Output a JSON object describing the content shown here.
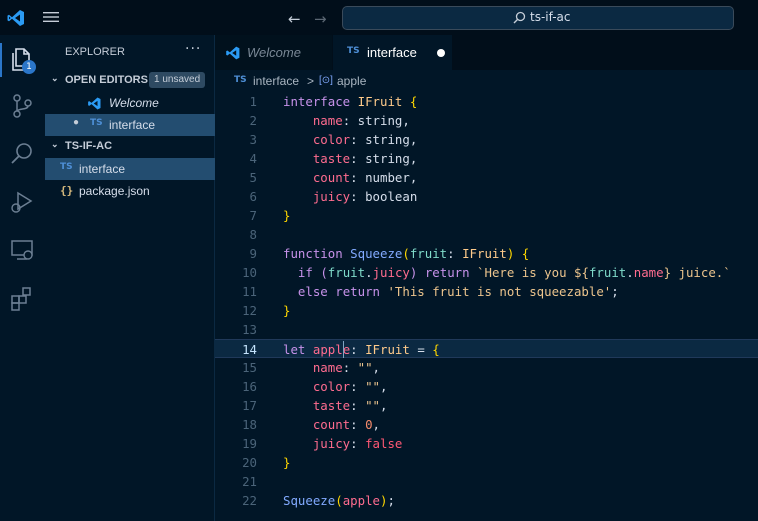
{
  "title_bar": {
    "back_glyph": "←",
    "forward_glyph": "→",
    "search_text": "ts-if-ac",
    "icons": [
      "vscode-logo-icon",
      "hamburger-menu-icon",
      "search-icon"
    ]
  },
  "activity_bar": {
    "icons": [
      "files-icon",
      "source-control-icon",
      "search-icon",
      "run-debug-icon",
      "remote-explorer-icon",
      "extensions-icon"
    ],
    "badge": "1"
  },
  "sidebar": {
    "title": "EXPLORER",
    "more_glyph": "···",
    "open_editors": {
      "label": "OPEN EDITORS",
      "badge": "1 unsaved",
      "chevron": "⌄",
      "items": [
        {
          "icon_label": "",
          "icon_name": "vscode-logo-icon",
          "label": "Welcome"
        },
        {
          "icon_label": "TS",
          "icon_name": "typescript-file-icon",
          "label": "interface",
          "dirty_glyph": "●"
        }
      ]
    },
    "workspace": {
      "label": "TS-IF-AC",
      "chevron": "⌄",
      "items": [
        {
          "icon_label": "TS",
          "icon_name": "typescript-file-icon",
          "label": "interface"
        },
        {
          "icon_label": "{}",
          "icon_name": "json-file-icon",
          "label": "package.json"
        }
      ]
    }
  },
  "tabs": [
    {
      "label": "Welcome",
      "icon_name": "vscode-logo-icon",
      "active": false
    },
    {
      "label": "interface",
      "icon_label": "TS",
      "icon_name": "typescript-file-icon",
      "active": true
    }
  ],
  "breadcrumb": {
    "file_icon": "TS",
    "file": "interface",
    "separator": ">",
    "symbol_icon": "[⊙]",
    "symbol": "apple"
  },
  "editor": {
    "current_line": 14,
    "lines": [
      {
        "n": "1",
        "tokens": [
          [
            "kw",
            "interface"
          ],
          [
            "va",
            " "
          ],
          [
            "ty",
            "IFruit"
          ],
          [
            "va",
            " "
          ],
          [
            "br",
            "{"
          ]
        ]
      },
      {
        "n": "2",
        "tokens": [
          [
            "va",
            "    "
          ],
          [
            "pr",
            "name"
          ],
          [
            "va",
            ": "
          ],
          [
            "va",
            "string,"
          ]
        ]
      },
      {
        "n": "3",
        "tokens": [
          [
            "va",
            "    "
          ],
          [
            "pr",
            "color"
          ],
          [
            "va",
            ": "
          ],
          [
            "va",
            "string,"
          ]
        ]
      },
      {
        "n": "4",
        "tokens": [
          [
            "va",
            "    "
          ],
          [
            "pr",
            "taste"
          ],
          [
            "va",
            ": "
          ],
          [
            "va",
            "string,"
          ]
        ]
      },
      {
        "n": "5",
        "tokens": [
          [
            "va",
            "    "
          ],
          [
            "pr",
            "count"
          ],
          [
            "va",
            ": "
          ],
          [
            "va",
            "number,"
          ]
        ]
      },
      {
        "n": "6",
        "tokens": [
          [
            "va",
            "    "
          ],
          [
            "pr",
            "juicy"
          ],
          [
            "va",
            ": "
          ],
          [
            "va",
            "boolean"
          ]
        ]
      },
      {
        "n": "7",
        "tokens": [
          [
            "br",
            "}"
          ]
        ]
      },
      {
        "n": "8",
        "tokens": []
      },
      {
        "n": "9",
        "tokens": [
          [
            "kw",
            "function"
          ],
          [
            "va",
            " "
          ],
          [
            "fn",
            "Squeeze"
          ],
          [
            "br",
            "("
          ],
          [
            "pa",
            "fruit"
          ],
          [
            "va",
            ": "
          ],
          [
            "ty",
            "IFruit"
          ],
          [
            "br",
            ")"
          ],
          [
            "va",
            " "
          ],
          [
            "br",
            "{"
          ]
        ]
      },
      {
        "n": "10",
        "tokens": [
          [
            "va",
            "  "
          ],
          [
            "kw",
            "if"
          ],
          [
            "va",
            " "
          ],
          [
            "pt",
            "("
          ],
          [
            "pa",
            "fruit"
          ],
          [
            "va",
            "."
          ],
          [
            "pr",
            "juicy"
          ],
          [
            "pt",
            ")"
          ],
          [
            "va",
            " "
          ],
          [
            "kw",
            "return"
          ],
          [
            "va",
            " "
          ],
          [
            "st",
            "`Here is you ${"
          ],
          [
            "pa",
            "fruit"
          ],
          [
            "va",
            "."
          ],
          [
            "pr",
            "name"
          ],
          [
            "st",
            "} juice.`"
          ]
        ]
      },
      {
        "n": "11",
        "tokens": [
          [
            "va",
            "  "
          ],
          [
            "kw",
            "else"
          ],
          [
            "va",
            " "
          ],
          [
            "kw",
            "return"
          ],
          [
            "va",
            " "
          ],
          [
            "st",
            "'This fruit is not squeezable'"
          ],
          [
            "va",
            ";"
          ]
        ]
      },
      {
        "n": "12",
        "tokens": [
          [
            "br",
            "}"
          ]
        ]
      },
      {
        "n": "13",
        "tokens": []
      },
      {
        "n": "14",
        "tokens": [
          [
            "kw",
            "let"
          ],
          [
            "va",
            " "
          ],
          [
            "pr",
            "apple"
          ],
          [
            "va",
            ": "
          ],
          [
            "ty",
            "IFruit"
          ],
          [
            "va",
            " = "
          ],
          [
            "br",
            "{"
          ]
        ]
      },
      {
        "n": "15",
        "tokens": [
          [
            "va",
            "    "
          ],
          [
            "pr",
            "name"
          ],
          [
            "va",
            ": "
          ],
          [
            "st",
            "\"\""
          ],
          [
            "va",
            ","
          ]
        ]
      },
      {
        "n": "16",
        "tokens": [
          [
            "va",
            "    "
          ],
          [
            "pr",
            "color"
          ],
          [
            "va",
            ": "
          ],
          [
            "st",
            "\"\""
          ],
          [
            "va",
            ","
          ]
        ]
      },
      {
        "n": "17",
        "tokens": [
          [
            "va",
            "    "
          ],
          [
            "pr",
            "taste"
          ],
          [
            "va",
            ": "
          ],
          [
            "st",
            "\"\""
          ],
          [
            "va",
            ","
          ]
        ]
      },
      {
        "n": "18",
        "tokens": [
          [
            "va",
            "    "
          ],
          [
            "pr",
            "count"
          ],
          [
            "va",
            ": "
          ],
          [
            "nu",
            "0"
          ],
          [
            "va",
            ","
          ]
        ]
      },
      {
        "n": "19",
        "tokens": [
          [
            "va",
            "    "
          ],
          [
            "pr",
            "juicy"
          ],
          [
            "va",
            ": "
          ],
          [
            "bo",
            "false"
          ]
        ]
      },
      {
        "n": "20",
        "tokens": [
          [
            "br",
            "}"
          ]
        ]
      },
      {
        "n": "21",
        "tokens": []
      },
      {
        "n": "22",
        "tokens": [
          [
            "fn",
            "Squeeze"
          ],
          [
            "br",
            "("
          ],
          [
            "pr",
            "apple"
          ],
          [
            "br",
            ")"
          ],
          [
            "va",
            ";"
          ]
        ]
      }
    ]
  },
  "colors": {
    "background": "#011627",
    "titlebar": "#010e1a",
    "selection": "#234d70",
    "accent": "#2b76c9",
    "keyword": "#c792ea",
    "type": "#ffcb8b",
    "property": "#ff6c8f",
    "string": "#ecc48d"
  }
}
